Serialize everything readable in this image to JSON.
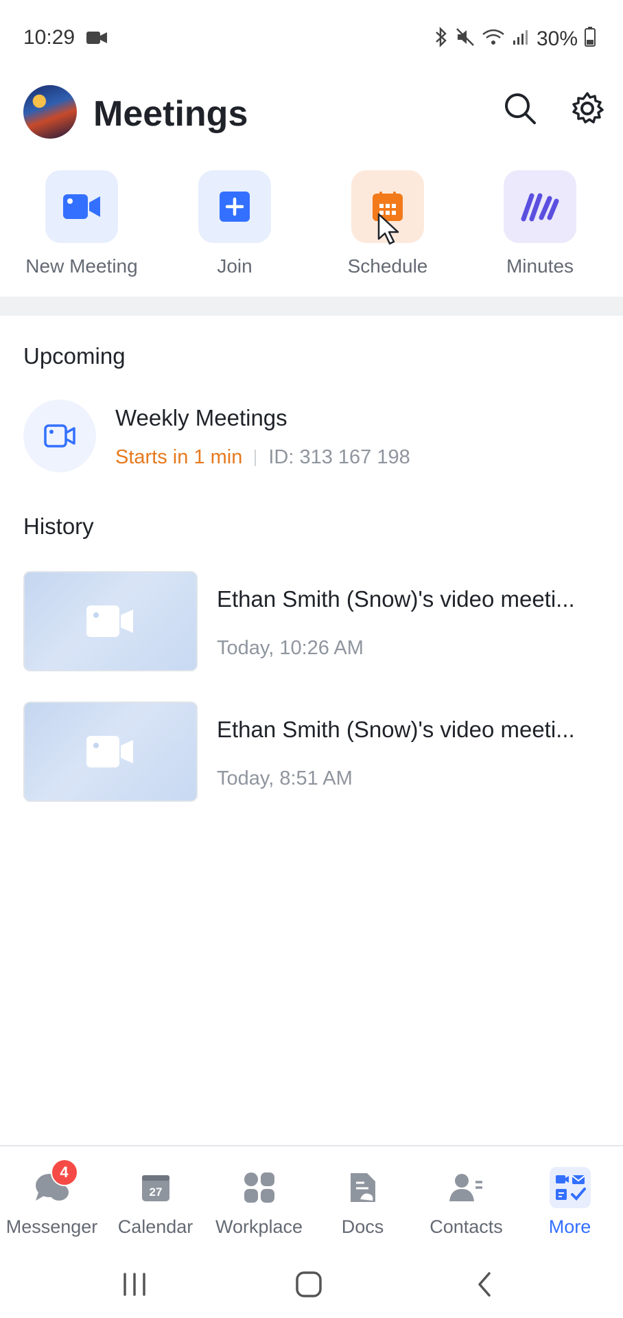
{
  "status_bar": {
    "time": "10:29",
    "battery": "30%"
  },
  "header": {
    "title": "Meetings"
  },
  "quick_actions": [
    {
      "label": "New Meeting"
    },
    {
      "label": "Join"
    },
    {
      "label": "Schedule"
    },
    {
      "label": "Minutes"
    }
  ],
  "upcoming": {
    "section_label": "Upcoming",
    "title": "Weekly Meetings",
    "starts": "Starts in 1 min",
    "id": "ID: 313 167 198"
  },
  "history": {
    "section_label": "History",
    "items": [
      {
        "title": "Ethan Smith (Snow)'s video meeti...",
        "time": "Today, 10:26 AM"
      },
      {
        "title": "Ethan Smith (Snow)'s video meeti...",
        "time": "Today, 8:51 AM"
      }
    ]
  },
  "bottom_nav": {
    "items": [
      {
        "label": "Messenger",
        "badge": "4"
      },
      {
        "label": "Calendar",
        "calendar_day": "27"
      },
      {
        "label": "Workplace"
      },
      {
        "label": "Docs"
      },
      {
        "label": "Contacts"
      },
      {
        "label": "More"
      }
    ]
  },
  "colors": {
    "accent": "#3370ff",
    "orange": "#e6791d",
    "badge": "#f54a45",
    "minutes": "#5b4fe0"
  }
}
